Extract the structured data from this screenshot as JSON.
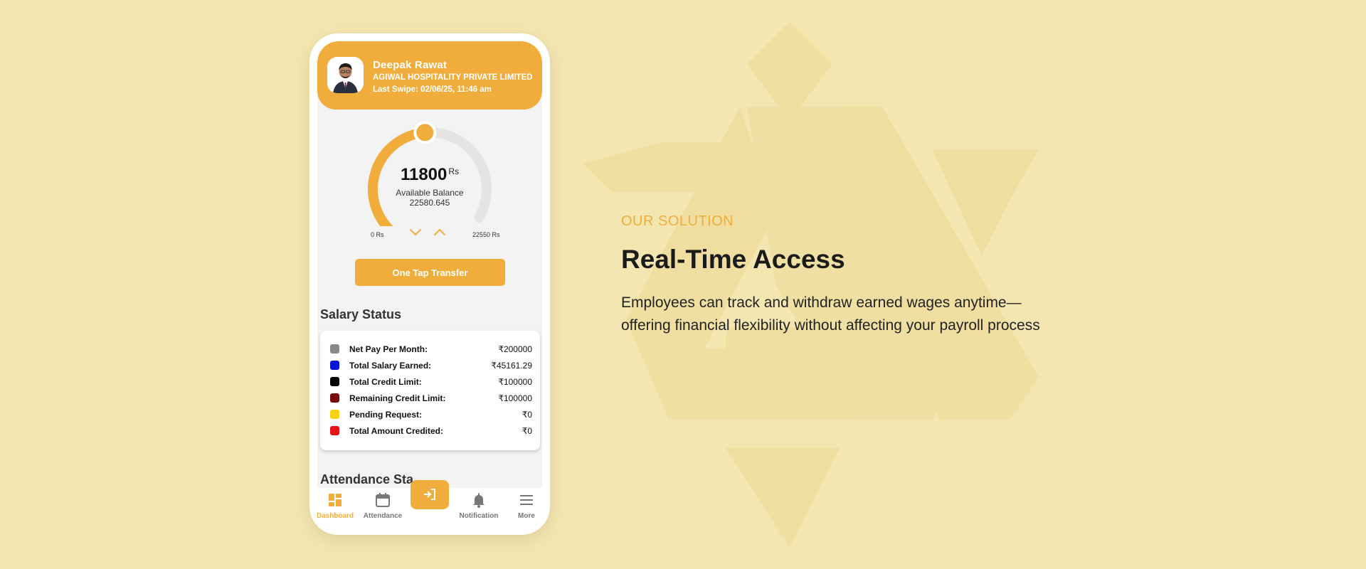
{
  "colors": {
    "background": "#f3e6b1",
    "accent": "#f0ad3c",
    "gauge_track": "#e4e4e4",
    "text_dark": "#1b1b1b"
  },
  "profile": {
    "name": "Deepak  Rawat",
    "company": "AGIWAL HOSPITALITY PRIVATE LIMITED",
    "last_swipe": "Last Swipe: 02/06/25, 11:46 am"
  },
  "balance": {
    "amount": "11800",
    "unit": "Rs",
    "label": "Available Balance",
    "secondary_value": "22580.645",
    "min_label": "0 Rs",
    "max_label": "22550 Rs",
    "fill_fraction": 0.52
  },
  "transfer_button": "One Tap Transfer",
  "salary_status": {
    "title": "Salary Status",
    "rows": [
      {
        "label": "Net Pay Per Month:",
        "value": "₹200000",
        "color": "#888888"
      },
      {
        "label": "Total Salary Earned:",
        "value": "₹45161.29",
        "color": "#0a14d6"
      },
      {
        "label": "Total Credit Limit:",
        "value": "₹100000",
        "color": "#000000"
      },
      {
        "label": "Remaining Credit Limit:",
        "value": "₹100000",
        "color": "#7a0a0a"
      },
      {
        "label": "Pending Request:",
        "value": "₹0",
        "color": "#f7d211"
      },
      {
        "label": "Total Amount Credited:",
        "value": "₹0",
        "color": "#e61414"
      }
    ]
  },
  "attendance_title": "Attendance Sta",
  "nav": {
    "dashboard": "Dashboard",
    "attendance": "Attendance",
    "notification": "Notification",
    "more": "More"
  },
  "icons": {
    "dashboard": "dashboard-icon",
    "attendance": "calendar-icon",
    "swipe": "login-arrow-icon",
    "notification": "bell-icon",
    "more": "menu-icon"
  },
  "hero": {
    "eyebrow": "OUR SOLUTION",
    "headline": "Real-Time Access",
    "description": "Employees can track and withdraw earned wages anytime—offering financial flexibility without affecting your payroll process"
  }
}
